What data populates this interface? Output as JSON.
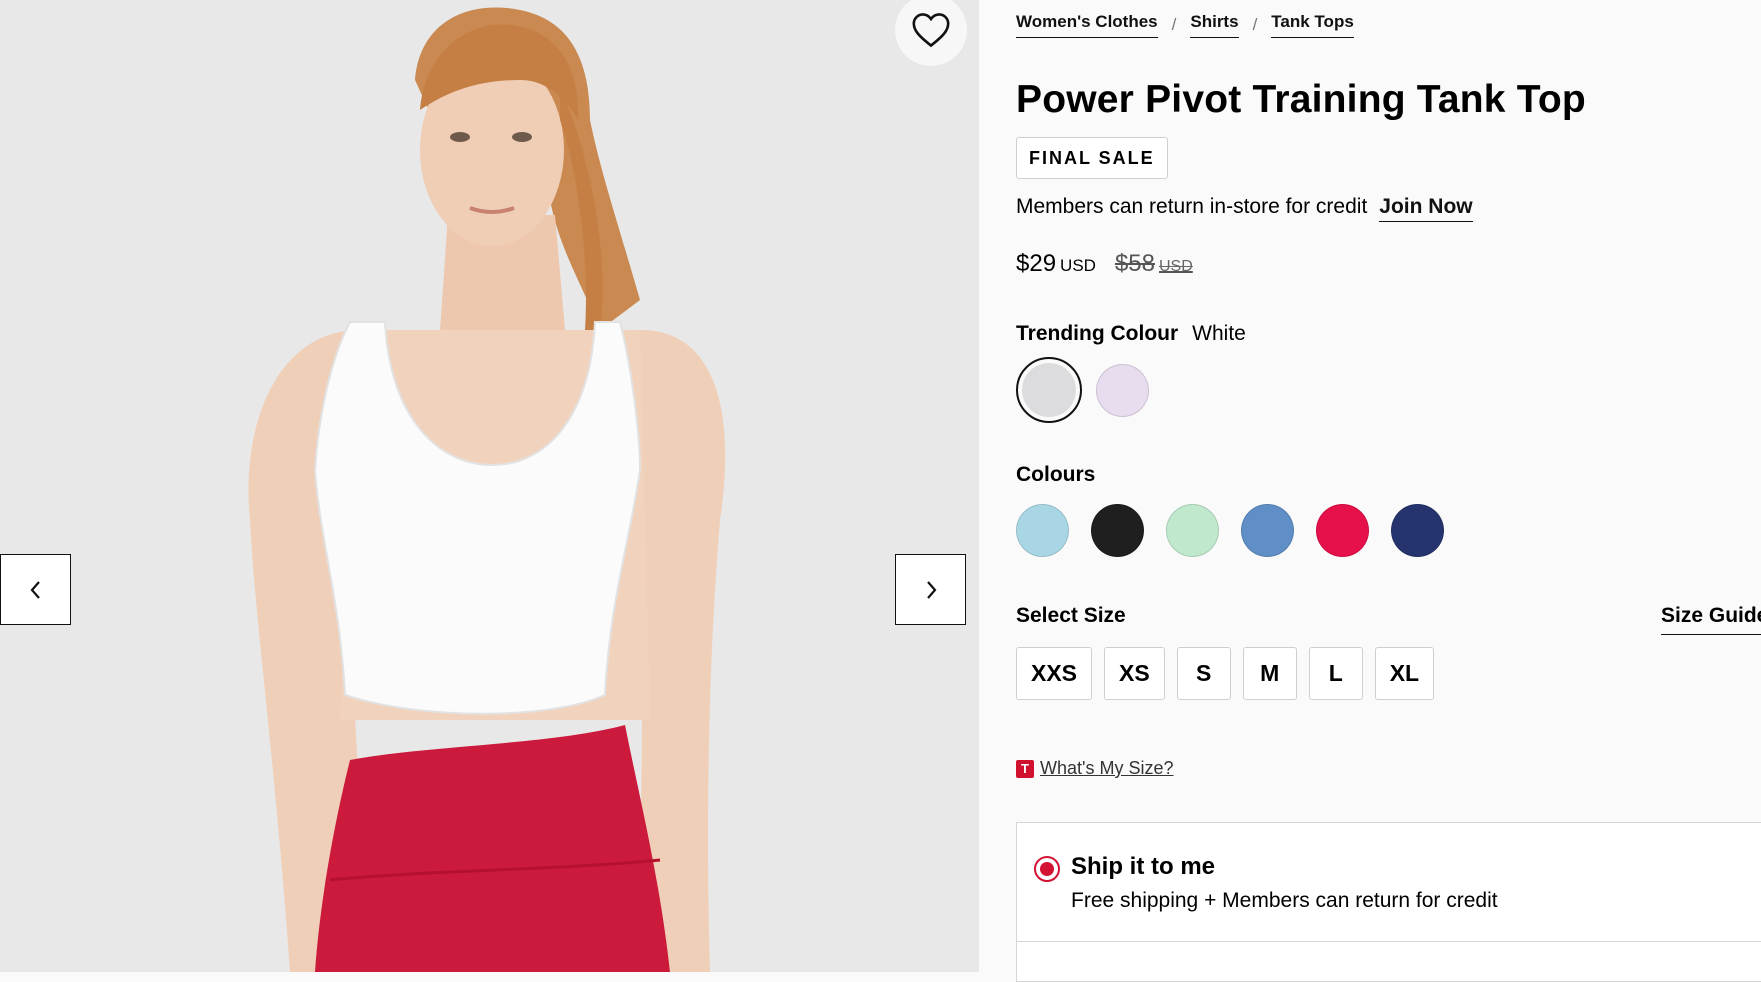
{
  "breadcrumb": [
    "Women's Clothes",
    "Shirts",
    "Tank Tops"
  ],
  "product": {
    "title": "Power Pivot Training Tank Top",
    "badge": "FINAL SALE",
    "member_text": "Members can return in-store for credit",
    "join_label": "Join Now",
    "price_now": "$29",
    "price_was": "$58",
    "currency": "USD"
  },
  "trending": {
    "label": "Trending Colour",
    "selected_name": "White",
    "swatches": [
      "#dcdcde",
      "#e8dcef"
    ]
  },
  "colours": {
    "label": "Colours",
    "swatches": [
      "#a9d6e4",
      "#1f1f1f",
      "#bfe8cc",
      "#5f8fc6",
      "#e6104b",
      "#25346e"
    ]
  },
  "size": {
    "label": "Select Size",
    "guide_label": "Size Guide",
    "options": [
      "XXS",
      "XS",
      "S",
      "M",
      "L",
      "XL"
    ]
  },
  "fit": {
    "logo": "T",
    "label": "What's My Size?"
  },
  "shipping": {
    "title": "Ship it to me",
    "subtitle": "Free shipping + Members can return for credit"
  },
  "icons": {
    "prev": "chevron-left-icon",
    "next": "chevron-right-icon",
    "wishlist": "heart-icon"
  }
}
